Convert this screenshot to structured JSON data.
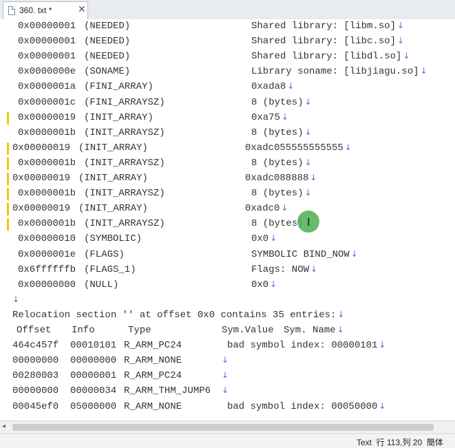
{
  "tab": {
    "title": "360. txt *",
    "close_glyph": "✕"
  },
  "eol_glyph": "↓",
  "dyn_lines": [
    {
      "tag": "0x00000001",
      "type": "(NEEDED)",
      "value": "Shared library: [libm.so]"
    },
    {
      "tag": "0x00000001",
      "type": "(NEEDED)",
      "value": "Shared library: [libc.so]"
    },
    {
      "tag": "0x00000001",
      "type": "(NEEDED)",
      "value": "Shared library: [libdl.so]"
    },
    {
      "tag": "0x0000000e",
      "type": "(SONAME)",
      "value": "Library soname: [libjiagu.so]"
    },
    {
      "tag": "0x0000001a",
      "type": "(FINI_ARRAY)",
      "value": "0xada8"
    },
    {
      "tag": "0x0000001c",
      "type": "(FINI_ARRAYSZ)",
      "value": "8 (bytes)"
    },
    {
      "tag": "0x00000019",
      "type": "(INIT_ARRAY)",
      "value": "0xa75"
    },
    {
      "tag": "0x0000001b",
      "type": "(INIT_ARRAYSZ)",
      "value": "8 (bytes)"
    },
    {
      "tag": "0x00000019",
      "type": "(INIT_ARRAY)",
      "value": "0xadc055555555555"
    },
    {
      "tag": "0x0000001b",
      "type": "(INIT_ARRAYSZ)",
      "value": "8 (bytes)"
    },
    {
      "tag": "0x00000019",
      "type": "(INIT_ARRAY)",
      "value": "0xadc088888"
    },
    {
      "tag": "0x0000001b",
      "type": "(INIT_ARRAYSZ)",
      "value": "8 (bytes)"
    },
    {
      "tag": "0x00000019",
      "type": "(INIT_ARRAY)",
      "value": "0xadc0"
    },
    {
      "tag": "0x0000001b",
      "type": "(INIT_ARRAYSZ)",
      "value": "8 (bytes)"
    },
    {
      "tag": "0x00000010",
      "type": "(SYMBOLIC)",
      "value": "0x0"
    },
    {
      "tag": "0x0000001e",
      "type": "(FLAGS)",
      "value": "SYMBOLIC BIND_NOW"
    },
    {
      "tag": "0x6ffffffb",
      "type": "(FLAGS_1)",
      "value": "Flags: NOW"
    },
    {
      "tag": "0x00000000",
      "type": "(NULL)",
      "value": "0x0"
    }
  ],
  "relocation_header": "Relocation section '' at offset 0x0 contains 35 entries:",
  "reloc_columns": [
    "Offset",
    "Info",
    "Type",
    "Sym.Value",
    "Sym. Name"
  ],
  "reloc_rows": [
    {
      "offset": "464c457f",
      "info": "00010101",
      "type": "R_ARM_PC24",
      "rest": "bad symbol index: 00000101"
    },
    {
      "offset": "00000000",
      "info": "00000000",
      "type": "R_ARM_NONE",
      "rest": ""
    },
    {
      "offset": "00280003",
      "info": "00000001",
      "type": "R_ARM_PC24",
      "rest": ""
    },
    {
      "offset": "00000000",
      "info": "00000034",
      "type": "R_ARM_THM_JUMP6",
      "rest": ""
    },
    {
      "offset": "00045ef0",
      "info": "05000000",
      "type": "R_ARM_NONE",
      "rest": "bad symbol index: 00050000"
    }
  ],
  "status_text": "Text  行 113,列 20  簡体"
}
